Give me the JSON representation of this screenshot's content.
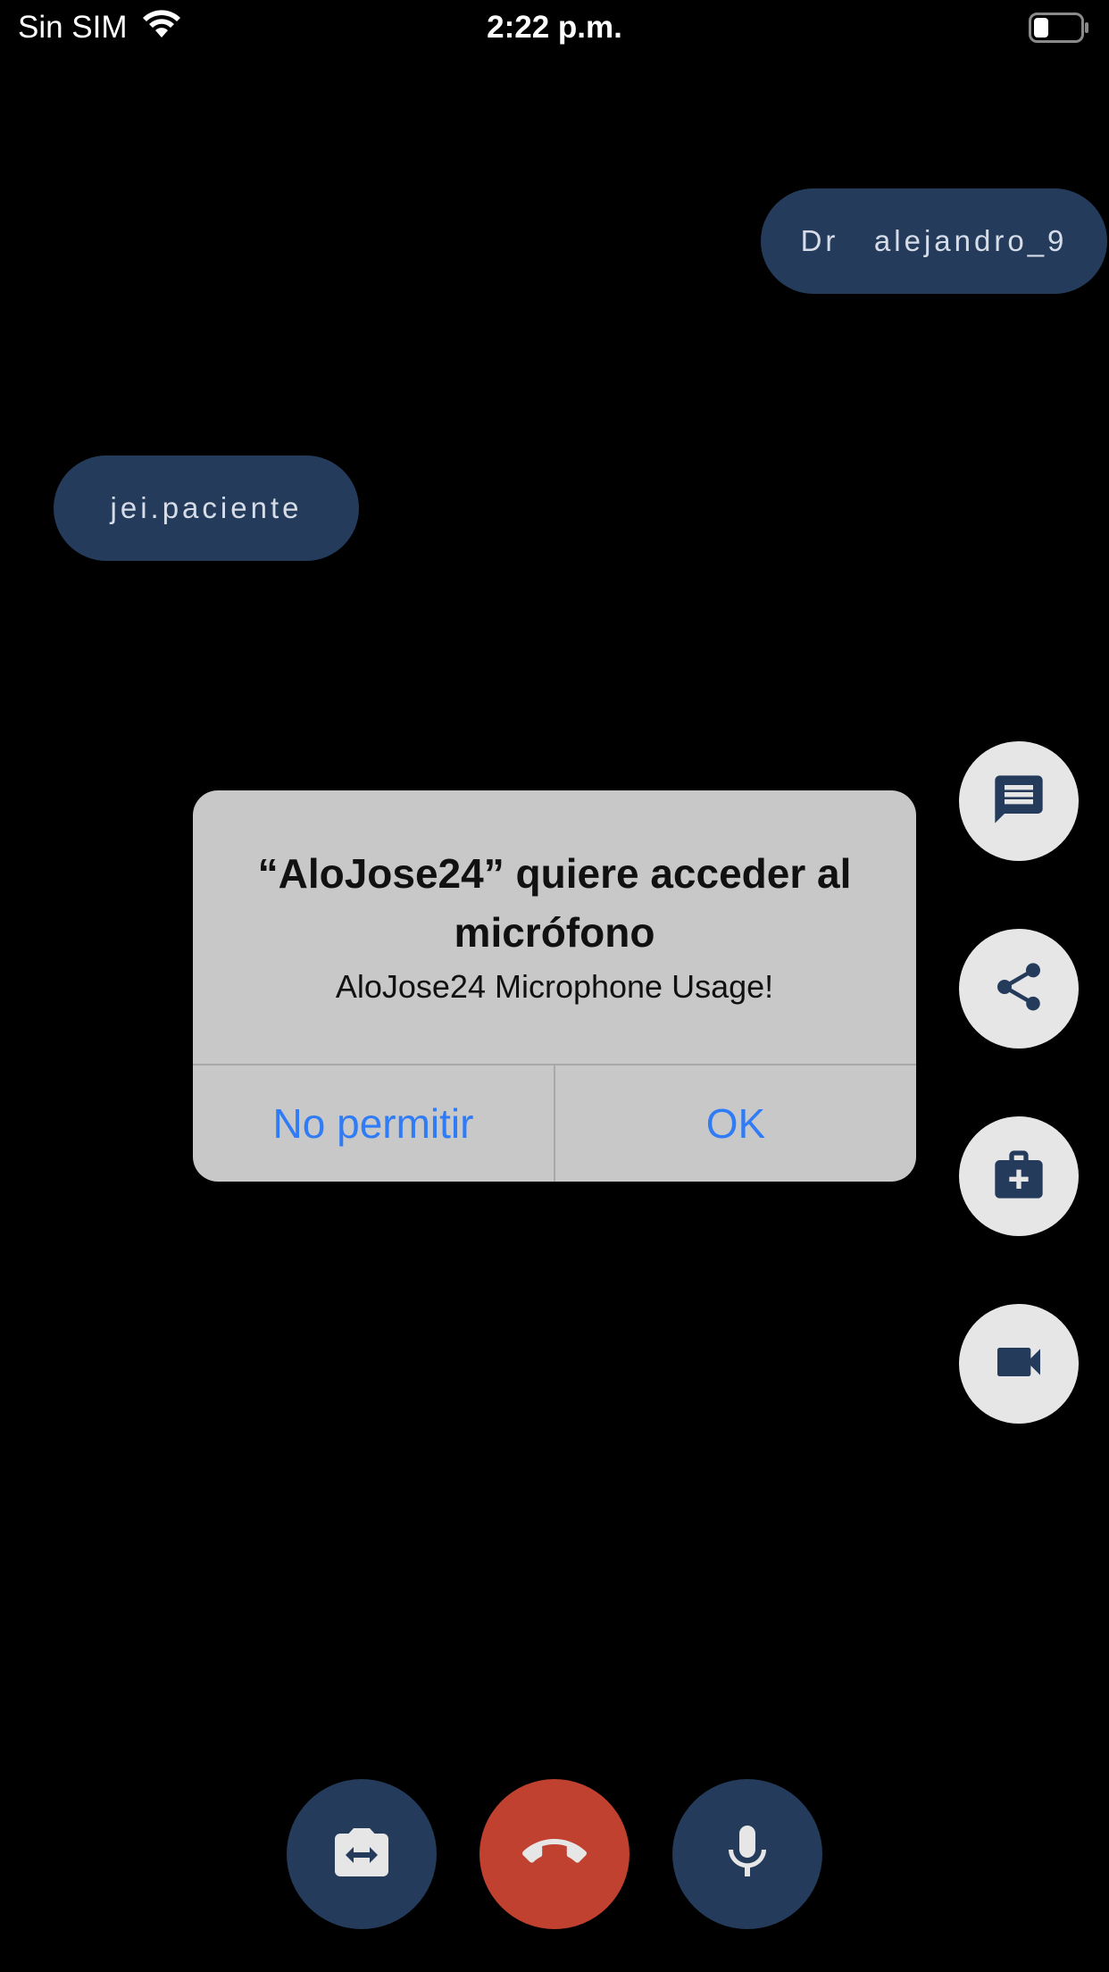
{
  "status_bar": {
    "carrier": "Sin SIM",
    "time": "2:22 p.m.",
    "wifi_icon": "wifi-icon",
    "battery_icon": "battery-low-icon"
  },
  "participants": {
    "doctor": "Dr   alejandro_9",
    "patient": "jei.paciente"
  },
  "side_actions": [
    {
      "icon": "chat-icon"
    },
    {
      "icon": "share-icon"
    },
    {
      "icon": "medical-kit-icon"
    },
    {
      "icon": "video-camera-icon"
    }
  ],
  "call_controls": [
    {
      "icon": "switch-camera-icon"
    },
    {
      "icon": "end-call-icon"
    },
    {
      "icon": "microphone-icon"
    }
  ],
  "alert": {
    "title": "“AloJose24” quiere acceder al micrófono",
    "message": "AloJose24 Microphone Usage!",
    "deny_label": "No permitir",
    "ok_label": "OK"
  },
  "colors": {
    "background": "#000000",
    "pill": "#253b5b",
    "end_call": "#c0412f",
    "side_button": "#e6e6e6",
    "alert_bg": "#c8c8c8",
    "alert_action": "#2f7cf6"
  }
}
